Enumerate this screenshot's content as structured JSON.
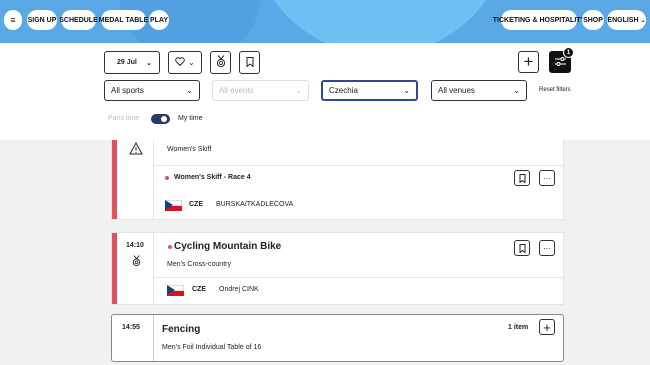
{
  "header": {
    "menu_icon": "menu-icon",
    "buttons": [
      "SIGN UP",
      "SCHEDULE",
      "MEDAL TABLE",
      "PLAY"
    ],
    "right_buttons": [
      "TICKETING & HOSPITALITY",
      "SHOP",
      "ENGLISH"
    ],
    "menu_glyph": "≡"
  },
  "filters": {
    "date": "29 Jul",
    "sports": "All sports",
    "events_placeholder": "All events",
    "country": "Czechia",
    "venues": "All venues",
    "reset": "Reset filters",
    "tz_paris": "Paris time",
    "tz_my": "My time",
    "badge_count": "1"
  },
  "cards": [
    {
      "title": "Women's Skiff",
      "row_title": "Women's Skiff - Race 4",
      "country_code": "CZE",
      "athletes": "BURSKA/TKADLECOVA"
    },
    {
      "time": "14:10",
      "title": "Cycling Mountain Bike",
      "subtitle": "Men's Cross-country",
      "country_code": "CZE",
      "athletes": "Ondrej CINK"
    },
    {
      "time": "14:55",
      "title": "Fencing",
      "subtitle": "Men's Foil Individual Table of 16",
      "items": "1 item"
    }
  ],
  "colors": {
    "header_blue": "#5aa9e6",
    "live_red": "#e0525b",
    "selected_border": "#2b4a9b"
  }
}
